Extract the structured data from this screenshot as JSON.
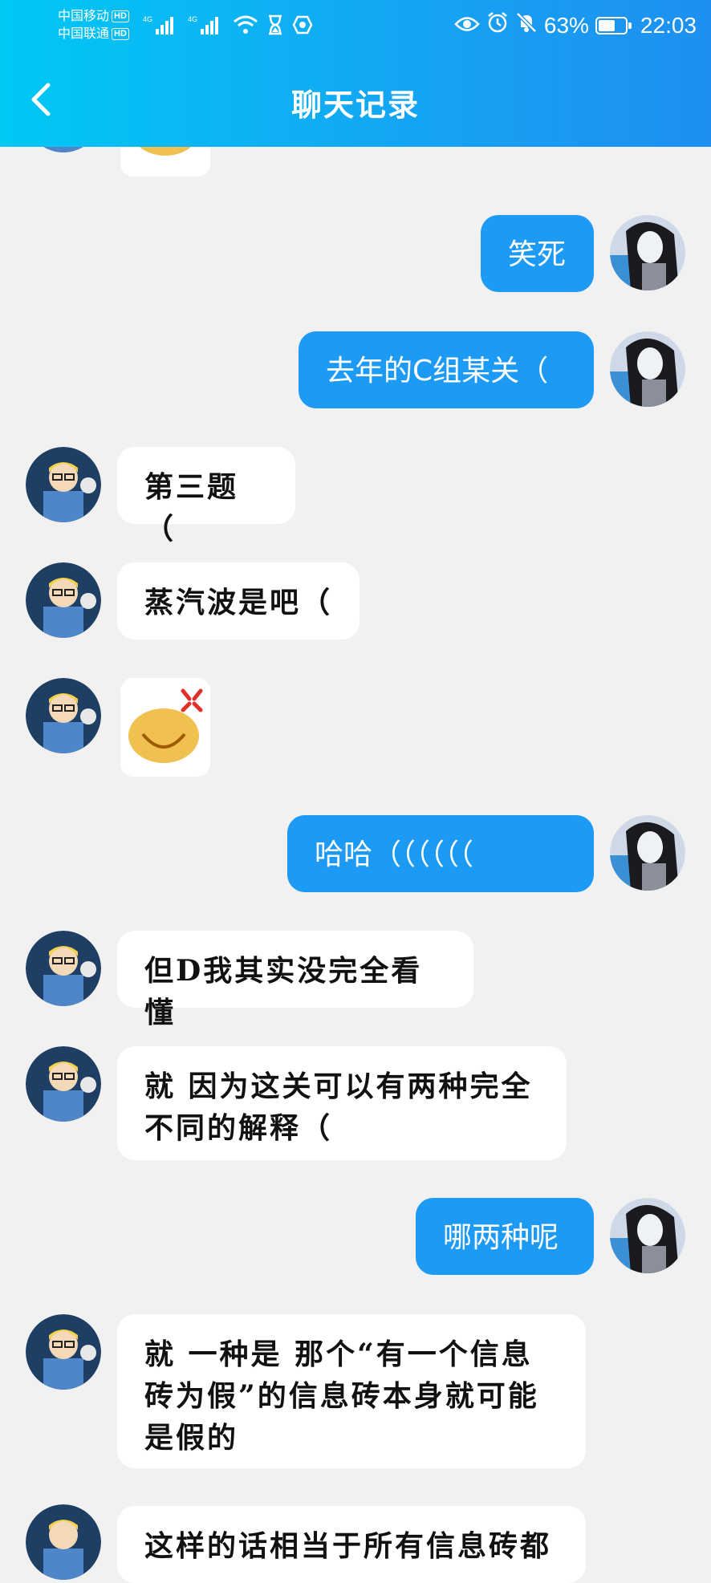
{
  "status_bar": {
    "carrier1": "中国移动",
    "carrier2": "中国联通",
    "hd": "HD",
    "network": "4G",
    "battery_percent": "63%",
    "battery_level": 0.63,
    "time": "22:03",
    "icons": [
      "signal-icon",
      "wifi-icon",
      "hourglass-icon",
      "shield-icon",
      "eye-icon",
      "alarm-icon",
      "mute-bell-icon",
      "battery-icon"
    ]
  },
  "header": {
    "title": "聊天记录",
    "back_icon": "back-chevron-icon"
  },
  "messages": [
    {
      "side": "in",
      "type": "sticker",
      "emoji": "smiling-face-sticker"
    },
    {
      "side": "out",
      "text": "笑死"
    },
    {
      "side": "out",
      "text": "去年的C组某关（"
    },
    {
      "side": "in",
      "text": "第三题（"
    },
    {
      "side": "in",
      "text": "蒸汽波是吧（"
    },
    {
      "side": "in",
      "type": "sticker",
      "emoji": "angry-smiling-face-sticker"
    },
    {
      "side": "out",
      "text": "哈哈（（（（（（"
    },
    {
      "side": "in",
      "text": "但D我其实没完全看懂"
    },
    {
      "side": "in",
      "text": "就 因为这关可以有两种完全\n不同的解释（"
    },
    {
      "side": "out",
      "text": "哪两种呢"
    },
    {
      "side": "in",
      "text": "就 一种是 那个“有一个信息\n砖为假”的信息砖本身就可能\n是假的"
    },
    {
      "side": "in",
      "text": "这样的话相当于所有信息砖都"
    }
  ],
  "colors": {
    "header_start": "#00c8f5",
    "header_end": "#1e8ff0",
    "out_bubble": "#1d9bf4",
    "in_bubble": "#ffffff",
    "background": "#f1f1f1"
  }
}
